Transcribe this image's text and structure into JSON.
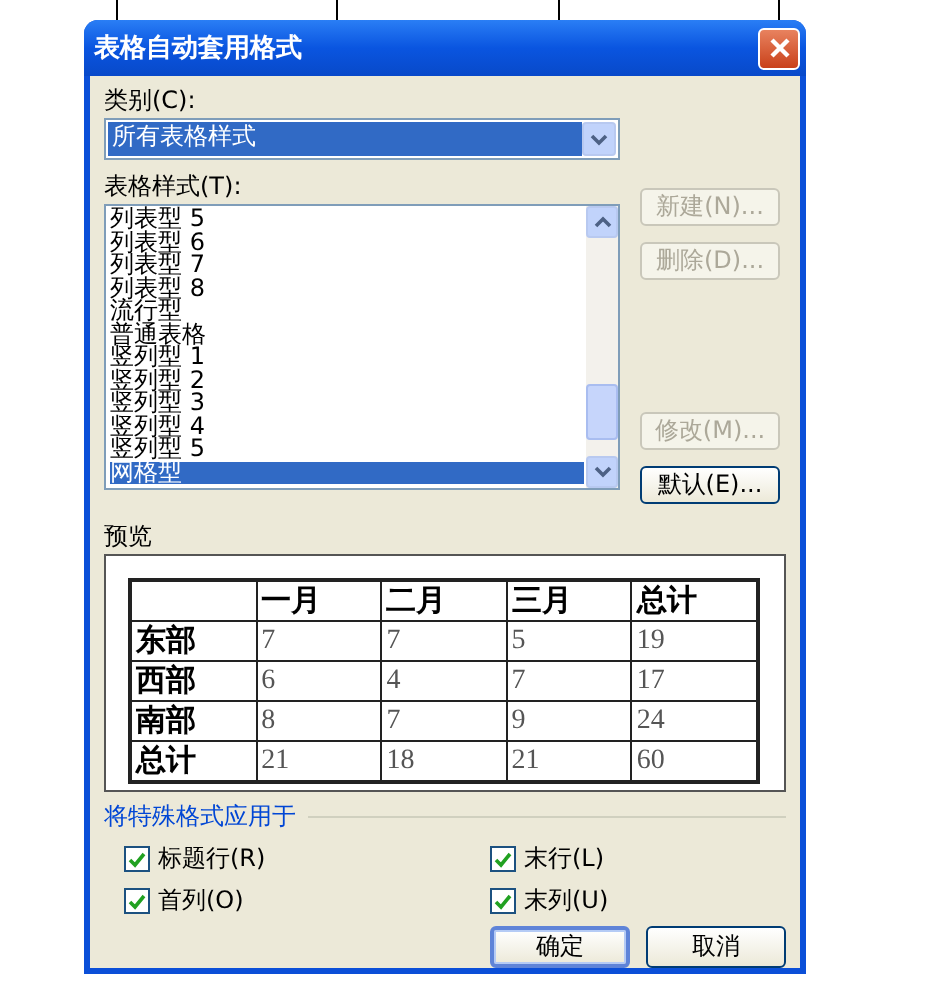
{
  "window": {
    "title": "表格自动套用格式"
  },
  "category": {
    "label": "类别(C):",
    "value": "所有表格样式"
  },
  "styles": {
    "label": "表格样式(T):",
    "items": [
      {
        "label": "列表型 5",
        "selected": false
      },
      {
        "label": "列表型 6",
        "selected": false
      },
      {
        "label": "列表型 7",
        "selected": false
      },
      {
        "label": "列表型 8",
        "selected": false
      },
      {
        "label": "流行型",
        "selected": false
      },
      {
        "label": "普通表格",
        "selected": false
      },
      {
        "label": "竖列型 1",
        "selected": false
      },
      {
        "label": "竖列型 2",
        "selected": false
      },
      {
        "label": "竖列型 3",
        "selected": false
      },
      {
        "label": "竖列型 4",
        "selected": false
      },
      {
        "label": "竖列型 5",
        "selected": false
      },
      {
        "label": "网格型",
        "selected": true
      }
    ]
  },
  "side_buttons": [
    {
      "label": "新建(N)...",
      "disabled": true
    },
    {
      "label": "删除(D)...",
      "disabled": true
    },
    {
      "label": "修改(M)...",
      "disabled": true
    },
    {
      "label": "默认(E)...",
      "disabled": false
    }
  ],
  "preview": {
    "label": "预览",
    "table": {
      "columns": [
        "一月",
        "二月",
        "三月",
        "总计"
      ],
      "rows": [
        {
          "label": "东部",
          "cells": [
            "7",
            "7",
            "5",
            "19"
          ]
        },
        {
          "label": "西部",
          "cells": [
            "6",
            "4",
            "7",
            "17"
          ]
        },
        {
          "label": "南部",
          "cells": [
            "8",
            "7",
            "9",
            "24"
          ]
        },
        {
          "label": "总计",
          "cells": [
            "21",
            "18",
            "21",
            "60"
          ]
        }
      ]
    }
  },
  "apply": {
    "label": "将特殊格式应用于",
    "options": [
      {
        "label": "标题行(R)",
        "checked": true
      },
      {
        "label": "末行(L)",
        "checked": true
      },
      {
        "label": "首列(O)",
        "checked": true
      },
      {
        "label": "末列(U)",
        "checked": true
      }
    ]
  },
  "buttons": [
    {
      "label": "确定",
      "default": true
    },
    {
      "label": "取消",
      "default": false
    }
  ]
}
